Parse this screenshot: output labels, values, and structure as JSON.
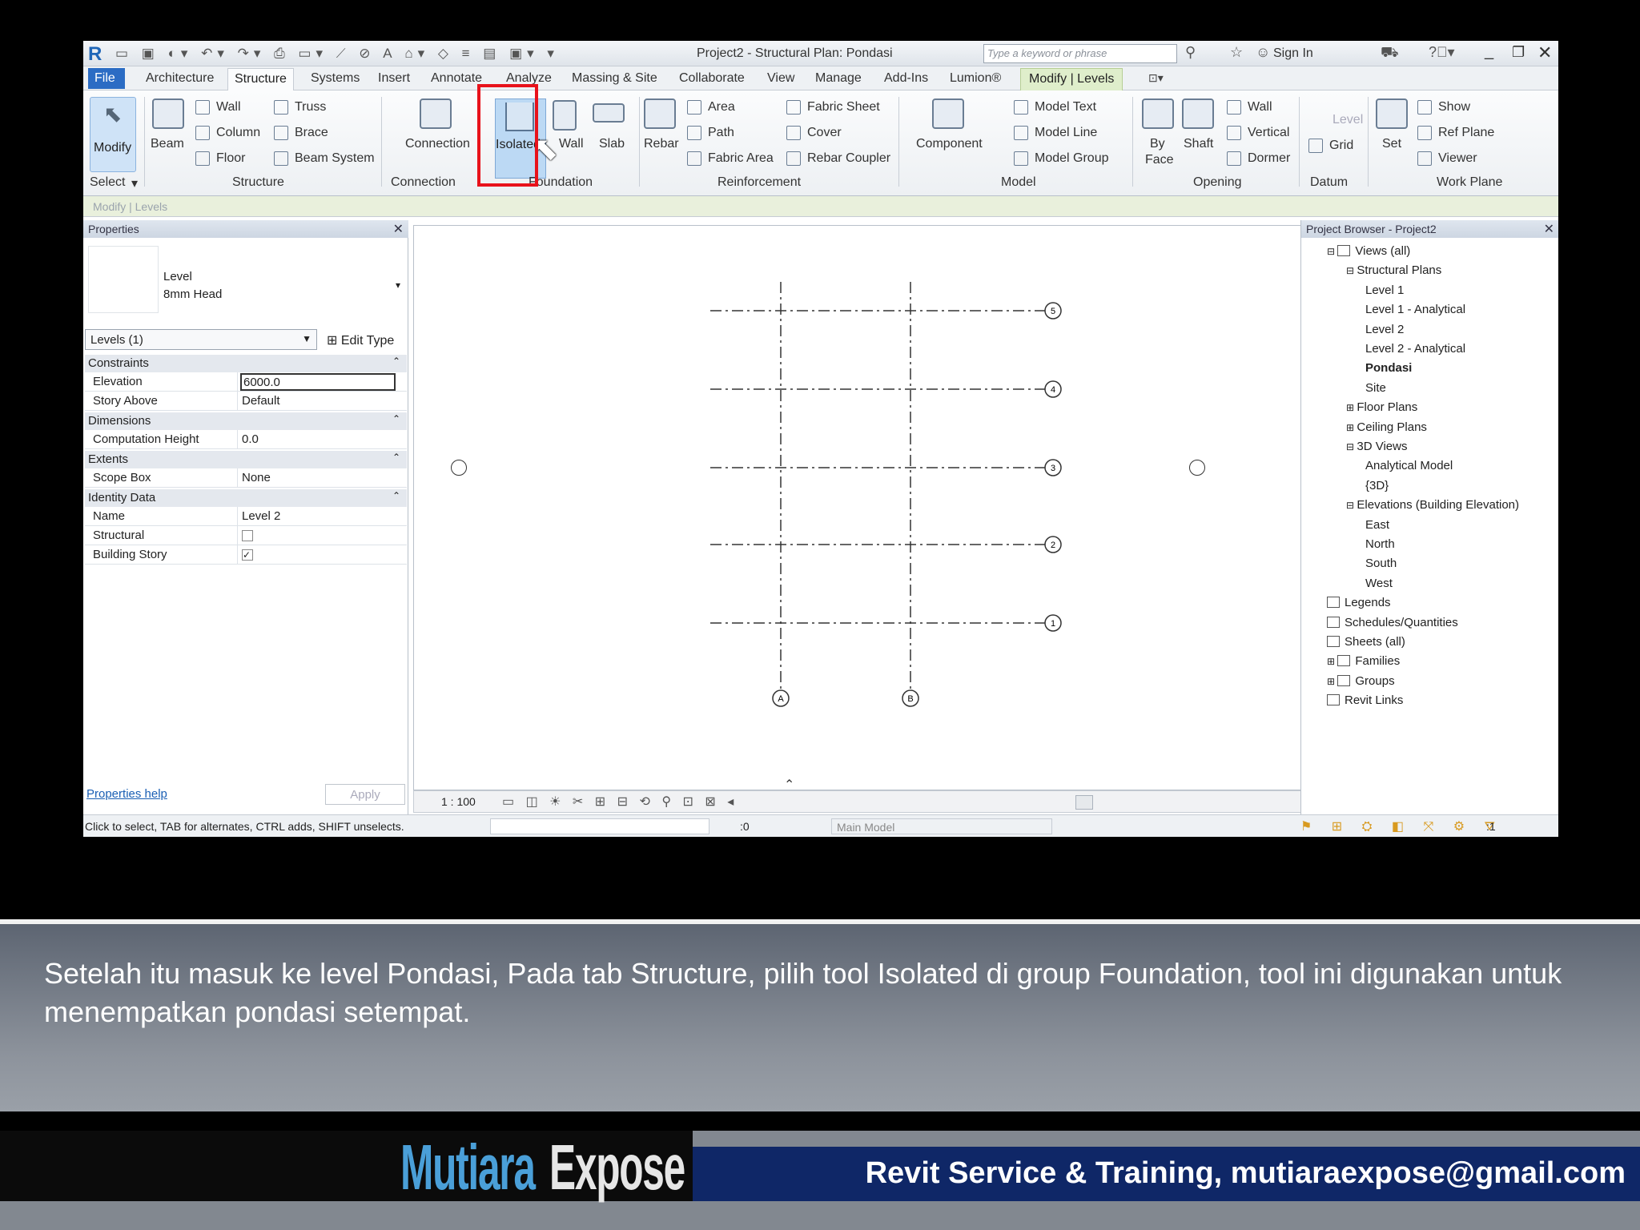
{
  "qat": {
    "title": "Project2 - Structural Plan: Pondasi",
    "search_placeholder": "Type a keyword or phrase",
    "signin": "Sign In"
  },
  "tabs": [
    "File",
    "Architecture",
    "Structure",
    "Systems",
    "Insert",
    "Annotate",
    "Analyze",
    "Massing & Site",
    "Collaborate",
    "View",
    "Manage",
    "Add-Ins",
    "Lumion®",
    "Modify | Levels"
  ],
  "ribbon": {
    "modify": "Modify",
    "beam": "Beam",
    "wall": "Wall",
    "column": "Column",
    "floor": "Floor",
    "truss": "Truss",
    "brace": "Brace",
    "beam_system": "Beam  System",
    "connection": "Connection",
    "isolated": "Isolated",
    "fwall": "Wall",
    "slab": "Slab",
    "rebar": "Rebar",
    "area": "Area",
    "path": "Path",
    "fabric_area": "Fabric  Area",
    "fabric_sheet": "Fabric  Sheet",
    "cover": "Cover",
    "rebar_coupler": "Rebar  Coupler",
    "component": "Component",
    "model_text": "Model  Text",
    "model_line": "Model  Line",
    "model_group": "Model  Group",
    "by_face_1": "By",
    "by_face_2": "Face",
    "shaft": "Shaft",
    "owall": "Wall",
    "vertical": "Vertical",
    "dormer": "Dormer",
    "level": "Level",
    "grid": "Grid",
    "set": "Set",
    "show": "Show",
    "ref_plane": "Ref  Plane",
    "viewer": "Viewer",
    "groups": {
      "select": "Select",
      "structure": "Structure",
      "connection": "Connection",
      "foundation": "Foundation",
      "reinforcement": "Reinforcement",
      "model": "Model",
      "opening": "Opening",
      "datum": "Datum",
      "work_plane": "Work Plane"
    }
  },
  "options_bar": "Modify | Levels",
  "properties": {
    "header": "Properties",
    "type_1": "Level",
    "type_2": "8mm Head",
    "selector": "Levels (1)",
    "edit_type": "Edit Type",
    "constraints": "Constraints",
    "elevation_label": "Elevation",
    "elevation_value": "6000.0",
    "story_label": "Story Above",
    "story_value": "Default",
    "dimensions": "Dimensions",
    "comp_label": "Computation Height",
    "comp_value": "0.0",
    "extents": "Extents",
    "scope_label": "Scope Box",
    "scope_value": "None",
    "identity": "Identity Data",
    "name_label": "Name",
    "name_value": "Level 2",
    "structural_label": "Structural",
    "building_label": "Building Story",
    "help": "Properties help",
    "apply": "Apply"
  },
  "canvas": {
    "scale": "1 : 100",
    "grid_rows": [
      "5",
      "4",
      "3",
      "2",
      "1"
    ],
    "grid_cols": [
      "A",
      "B"
    ]
  },
  "browser": {
    "header": "Project Browser - Project2",
    "items": [
      "Views (all)",
      "Structural Plans",
      "Level 1",
      "Level 1 - Analytical",
      "Level 2",
      "Level 2 - Analytical",
      "Pondasi",
      "Site",
      "Floor Plans",
      "Ceiling Plans",
      "3D Views",
      "Analytical Model",
      "{3D}",
      "Elevations (Building Elevation)",
      "East",
      "North",
      "South",
      "West",
      "Legends",
      "Schedules/Quantities",
      "Sheets (all)",
      "Families",
      "Groups",
      "Revit Links"
    ]
  },
  "status": {
    "hint": "Click to select, TAB for alternates, CTRL adds, SHIFT unselects.",
    "zero": ":0",
    "model": "Main Model",
    "filter": ":1"
  },
  "caption": "Setelah itu masuk ke level Pondasi, Pada tab Structure, pilih tool Isolated di group Foundation, tool ini digunakan untuk menempatkan pondasi setempat.",
  "footer": {
    "logo_a": "Mutiara",
    "logo_b": "Expose",
    "contact": "Revit Service & Training, mutiaraexpose@gmail.com"
  },
  "colors": {
    "highlight": "#e8121b",
    "file_tab": "#2b6cc4",
    "footer_bar": "#0f2767"
  }
}
